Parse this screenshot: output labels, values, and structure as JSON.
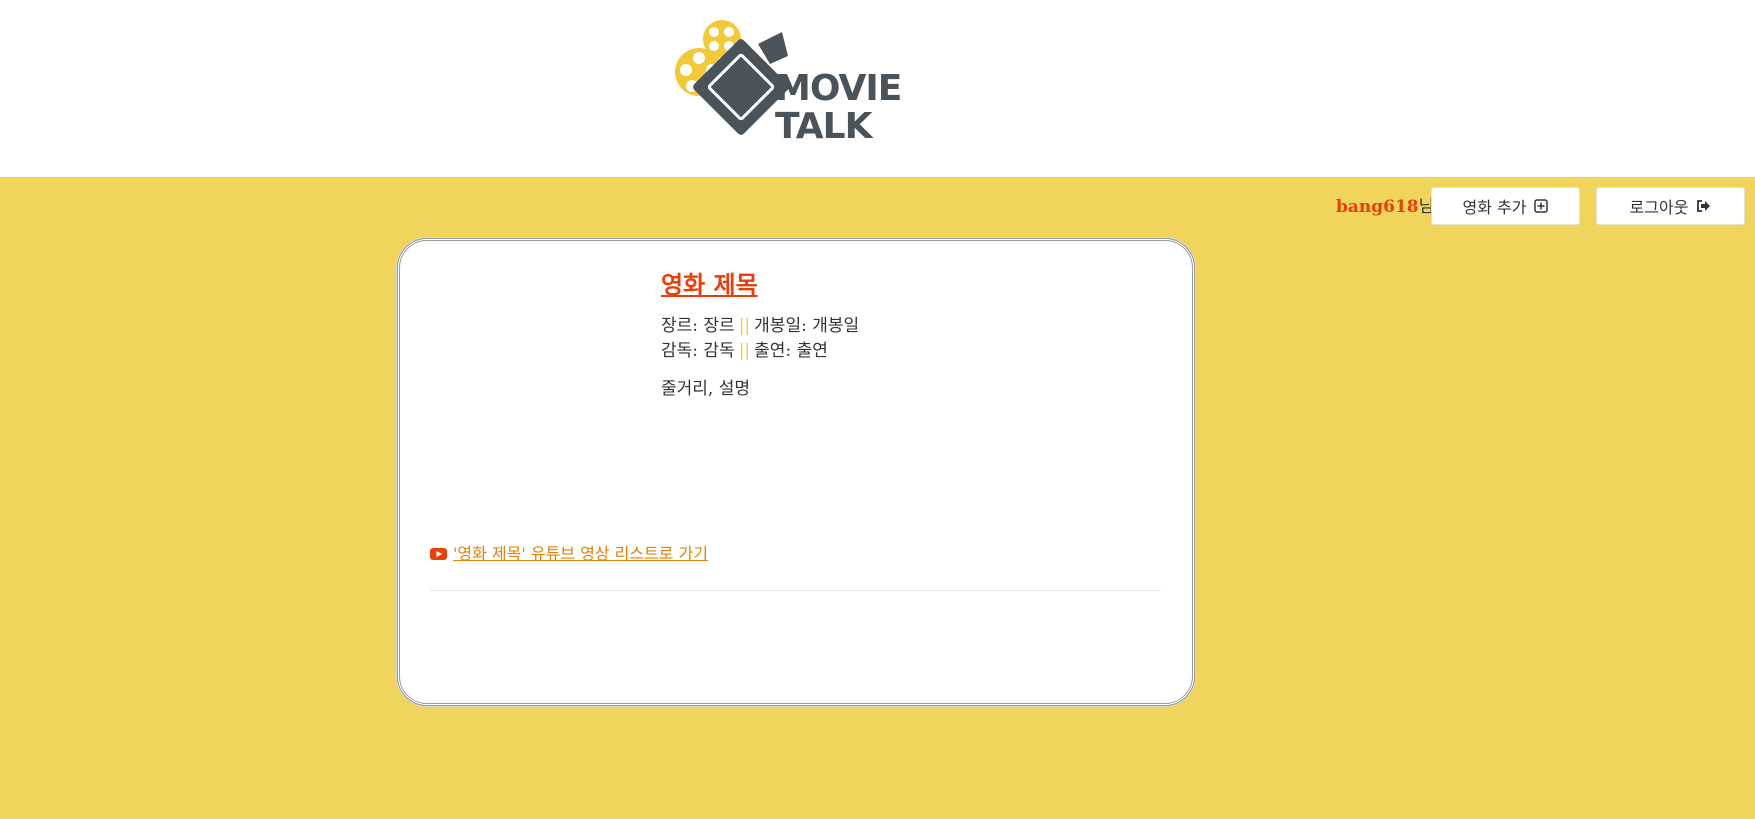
{
  "header": {
    "logo_line1": "MOVIE",
    "logo_line2": "TALK",
    "logo_icon": "film-camera-icon",
    "colors": {
      "reel": "#f1c93a",
      "camera": "#4b535a"
    }
  },
  "user_bar": {
    "username": "bang618",
    "suffix": "님",
    "add_movie_label": "영화 추가",
    "add_movie_icon": "plus-square-icon",
    "logout_label": "로그아웃",
    "logout_icon": "sign-out-icon"
  },
  "movie": {
    "title": "영화 제목",
    "genre_label": "장르:",
    "genre_value": "장르",
    "release_label": "개봉일:",
    "release_value": "개봉일",
    "director_label": "감독:",
    "director_value": "감독",
    "cast_label": "출연:",
    "cast_value": "출연",
    "separator": "||",
    "plot": "줄거리, 설명"
  },
  "youtube": {
    "icon": "youtube-icon",
    "link_text": "'영화 제목' 유튜브 영상 리스트로 가기"
  },
  "theme": {
    "background": "#f1d45b",
    "accent": "#e8400c",
    "link": "#e0820a"
  }
}
